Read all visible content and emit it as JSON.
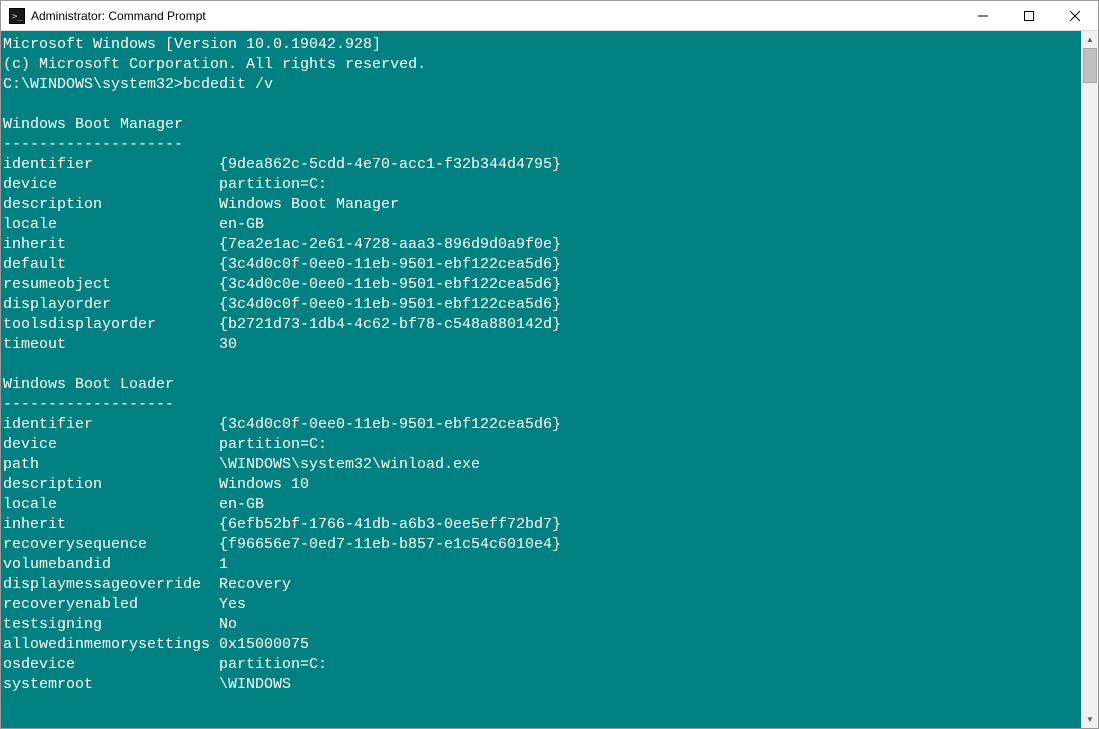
{
  "titlebar": {
    "title": "Administrator: Command Prompt"
  },
  "terminal": {
    "header": {
      "line1": "Microsoft Windows [Version 10.0.19042.928]",
      "line2": "(c) Microsoft Corporation. All rights reserved."
    },
    "prompt": "C:\\WINDOWS\\system32>",
    "command": "bcdedit /v",
    "sections": [
      {
        "title": "Windows Boot Manager",
        "divider": "--------------------",
        "entries": [
          {
            "key": "identifier",
            "value": "{9dea862c-5cdd-4e70-acc1-f32b344d4795}"
          },
          {
            "key": "device",
            "value": "partition=C:"
          },
          {
            "key": "description",
            "value": "Windows Boot Manager"
          },
          {
            "key": "locale",
            "value": "en-GB"
          },
          {
            "key": "inherit",
            "value": "{7ea2e1ac-2e61-4728-aaa3-896d9d0a9f0e}"
          },
          {
            "key": "default",
            "value": "{3c4d0c0f-0ee0-11eb-9501-ebf122cea5d6}"
          },
          {
            "key": "resumeobject",
            "value": "{3c4d0c0e-0ee0-11eb-9501-ebf122cea5d6}"
          },
          {
            "key": "displayorder",
            "value": "{3c4d0c0f-0ee0-11eb-9501-ebf122cea5d6}"
          },
          {
            "key": "toolsdisplayorder",
            "value": "{b2721d73-1db4-4c62-bf78-c548a880142d}"
          },
          {
            "key": "timeout",
            "value": "30"
          }
        ]
      },
      {
        "title": "Windows Boot Loader",
        "divider": "-------------------",
        "entries": [
          {
            "key": "identifier",
            "value": "{3c4d0c0f-0ee0-11eb-9501-ebf122cea5d6}"
          },
          {
            "key": "device",
            "value": "partition=C:"
          },
          {
            "key": "path",
            "value": "\\WINDOWS\\system32\\winload.exe"
          },
          {
            "key": "description",
            "value": "Windows 10"
          },
          {
            "key": "locale",
            "value": "en-GB"
          },
          {
            "key": "inherit",
            "value": "{6efb52bf-1766-41db-a6b3-0ee5eff72bd7}"
          },
          {
            "key": "recoverysequence",
            "value": "{f96656e7-0ed7-11eb-b857-e1c54c6010e4}"
          },
          {
            "key": "volumebandid",
            "value": "1"
          },
          {
            "key": "displaymessageoverride",
            "value": "Recovery"
          },
          {
            "key": "recoveryenabled",
            "value": "Yes"
          },
          {
            "key": "testsigning",
            "value": "No"
          },
          {
            "key": "allowedinmemorysettings",
            "value": "0x15000075"
          },
          {
            "key": "osdevice",
            "value": "partition=C:"
          },
          {
            "key": "systemroot",
            "value": "\\WINDOWS"
          }
        ]
      }
    ]
  }
}
